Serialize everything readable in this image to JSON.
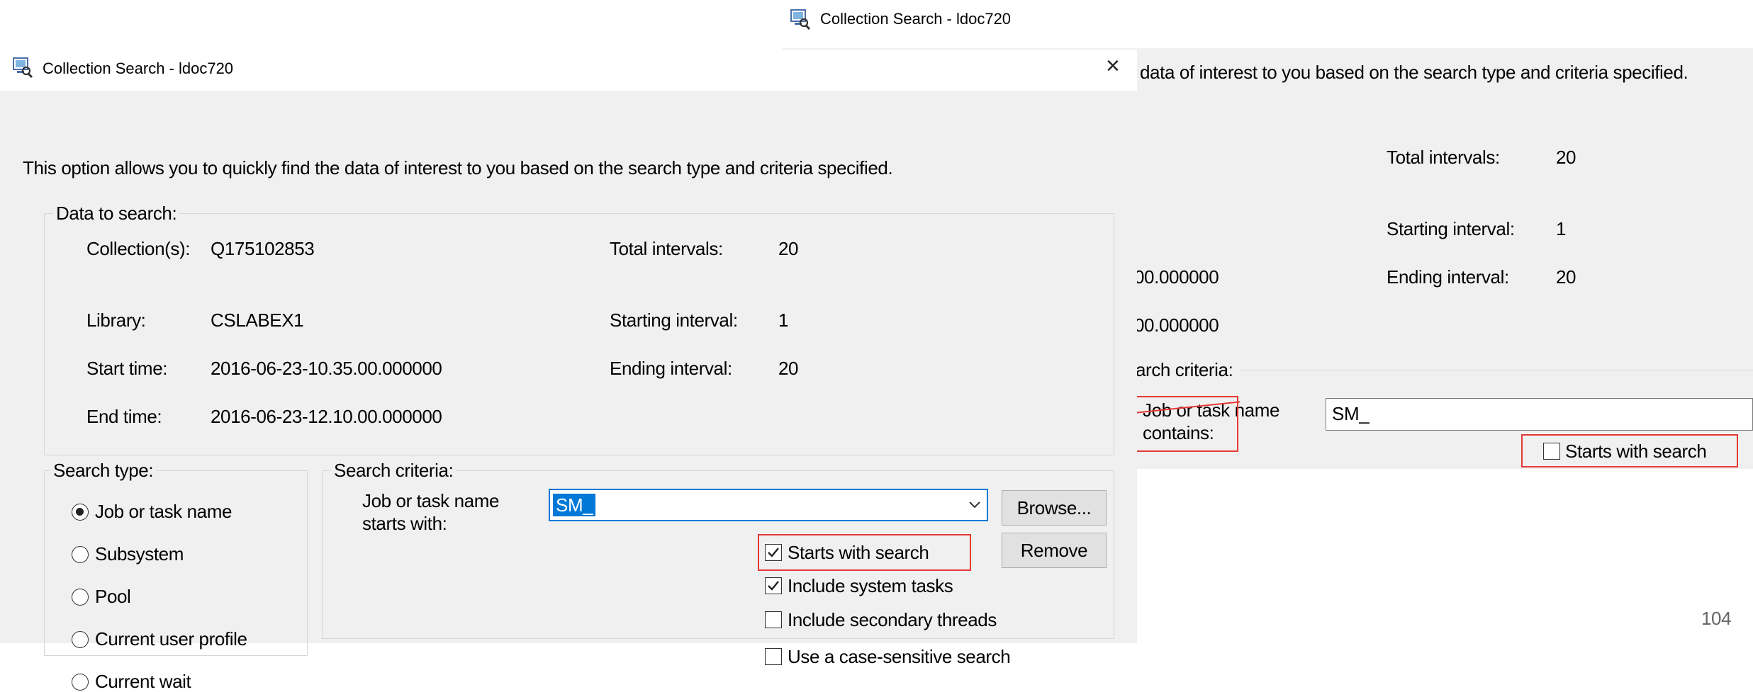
{
  "back_window": {
    "title": "Collection Search - ldoc720",
    "description_tail": "data of interest to you based on the search type and criteria specified.",
    "total_intervals_label": "Total intervals:",
    "total_intervals_value": "20",
    "starting_interval_label": "Starting interval:",
    "starting_interval_value": "1",
    "ending_interval_label": "Ending interval:",
    "ending_interval_value": "20",
    "start_time_tail": "00.000000",
    "end_time_tail": "00.000000",
    "search_criteria_legend": "arch criteria:",
    "job_label_line1": "Job or task name",
    "job_label_line2": "contains:",
    "search_value": "SM_",
    "starts_with_label": "Starts with search",
    "starts_with_checked": false
  },
  "front_window": {
    "title": "Collection Search - ldoc720",
    "close_glyph": "×",
    "description": "This option allows you to quickly find the data of interest to you based on the search type and criteria specified.",
    "data_group_legend": "Data to search:",
    "collection_label": "Collection(s):",
    "collection_value": "Q175102853",
    "library_label": "Library:",
    "library_value": "CSLABEX1",
    "start_time_label": "Start time:",
    "start_time_value": "2016-06-23-10.35.00.000000",
    "end_time_label": "End time:",
    "end_time_value": "2016-06-23-12.10.00.000000",
    "total_intervals_label": "Total intervals:",
    "total_intervals_value": "20",
    "starting_interval_label": "Starting interval:",
    "starting_interval_value": "1",
    "ending_interval_label": "Ending interval:",
    "ending_interval_value": "20",
    "search_type_legend": "Search type:",
    "search_types": [
      "Job or task name",
      "Subsystem",
      "Pool",
      "Current user profile",
      "Current wait"
    ],
    "selected_search_type": "Job or task name",
    "criteria_legend": "Search criteria:",
    "job_label_line1": "Job or task name",
    "job_label_line2": "starts with:",
    "search_value": "SM_",
    "browse_label": "Browse...",
    "remove_label": "Remove",
    "options": [
      {
        "label": "Starts with search",
        "checked": true
      },
      {
        "label": "Include system tasks",
        "checked": true
      },
      {
        "label": "Include secondary threads",
        "checked": false
      },
      {
        "label": "Use a case-sensitive search",
        "checked": false
      }
    ]
  },
  "page_number": "104",
  "colors": {
    "dialog_bg": "#f0f0f0",
    "highlight": "#0078d7",
    "annotation_red": "#e53935"
  }
}
